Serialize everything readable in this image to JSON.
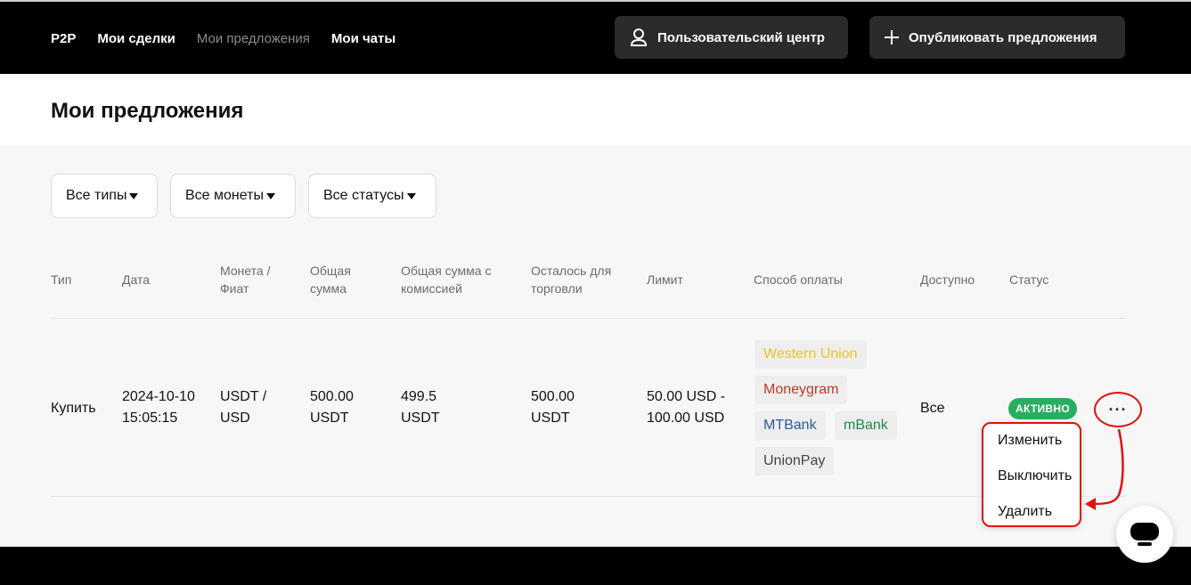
{
  "header": {
    "nav": [
      "P2P",
      "Мои сделки",
      "Мои предложения",
      "Мои чаты"
    ],
    "user_center_label": "Пользовательский центр",
    "publish_label": "Опубликовать предложения"
  },
  "page": {
    "title": "Мои предложения"
  },
  "filters": {
    "types": "Все типы",
    "coins": "Все монеты",
    "statuses": "Все статусы"
  },
  "table": {
    "headers": {
      "type": "Тип",
      "date": "Дата",
      "coin_fiat": "Монета / Фиат",
      "total": "Общая сумма",
      "total_fee": "Общая сумма с комиссией",
      "remaining": "Осталось для торговли",
      "limit": "Лимит",
      "payment": "Способ оплаты",
      "available": "Доступно",
      "status": "Статус"
    },
    "row": {
      "type": "Купить",
      "date": "2024-10-10",
      "time": "15:05:15",
      "coin": "USDT /",
      "fiat": "USD",
      "total": "500.00",
      "total_unit": "USDT",
      "total_fee": "499.5",
      "total_fee_unit": "USDT",
      "remaining": "500.00",
      "remaining_unit": "USDT",
      "limit_min": "50.00 USD -",
      "limit_max": "100.00 USD",
      "payments": [
        "Western Union",
        "Moneygram",
        "MTBank",
        "mBank",
        "UnionPay"
      ],
      "available": "Все",
      "status": "АКТИВНО",
      "more": "···"
    }
  },
  "menu": {
    "items": [
      "Изменить",
      "Выключить",
      "Удалить"
    ]
  },
  "colors": {
    "status_green": "#27ae60",
    "annotation_red": "#e01010",
    "western_union": "#f0c419",
    "moneygram": "#c0392b",
    "mtbank": "#2c5aa0",
    "mbank": "#1e8a4c",
    "unionpay": "#444444"
  }
}
